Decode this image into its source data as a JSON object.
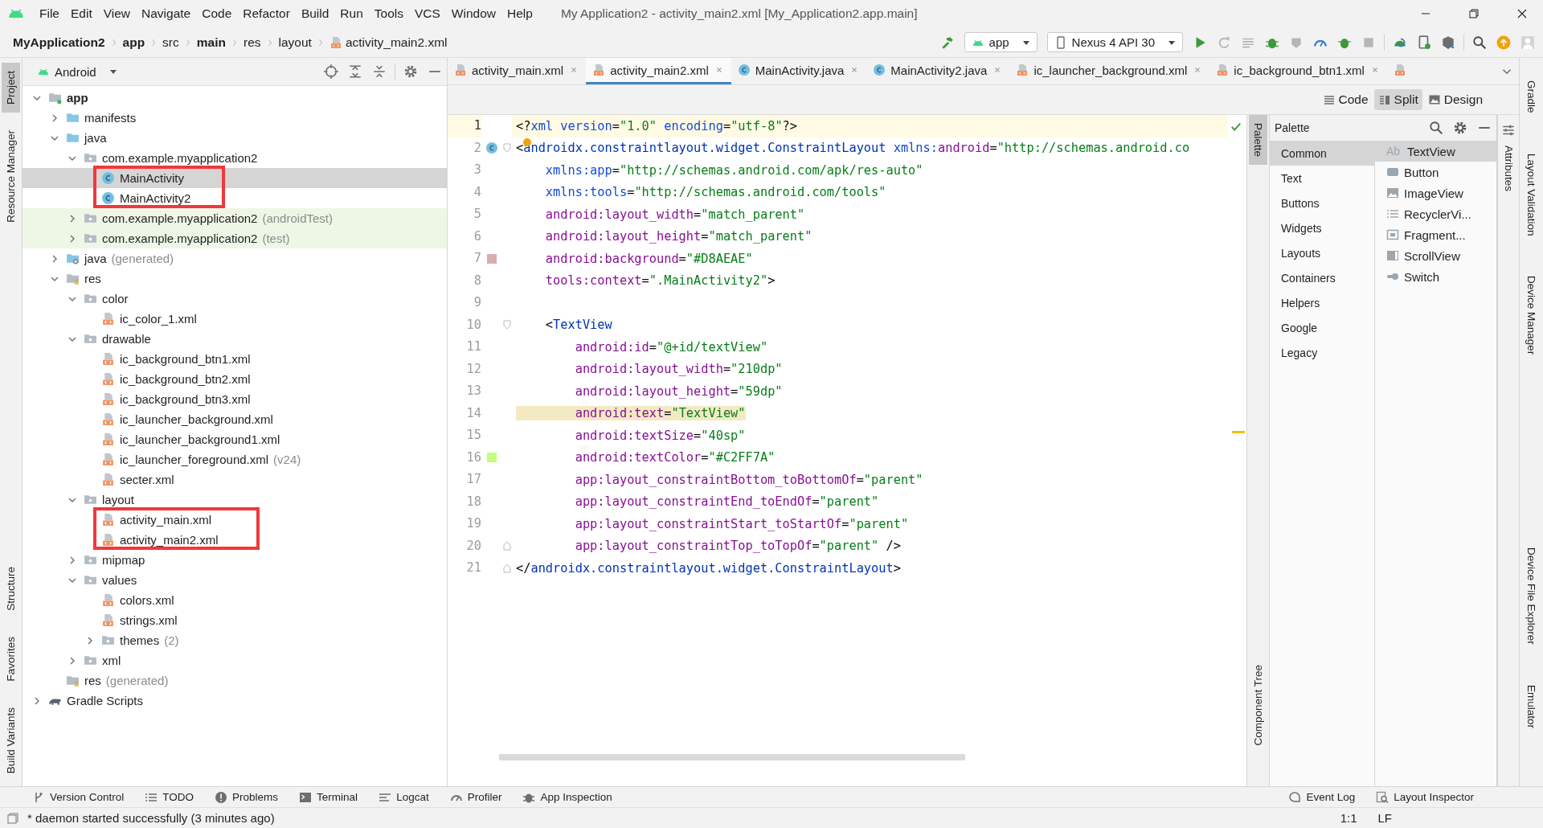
{
  "window": {
    "title": "My Application2 - activity_main2.xml [My_Application2.app.main]",
    "menu": [
      "File",
      "Edit",
      "View",
      "Navigate",
      "Code",
      "Refactor",
      "Build",
      "Run",
      "Tools",
      "VCS",
      "Window",
      "Help"
    ]
  },
  "breadcrumb": [
    {
      "label": "MyApplication2",
      "bold": true,
      "kind": "dir"
    },
    {
      "label": "app",
      "bold": true,
      "kind": "dir"
    },
    {
      "label": "src",
      "bold": false,
      "kind": "dir"
    },
    {
      "label": "main",
      "bold": true,
      "kind": "dir"
    },
    {
      "label": "res",
      "bold": false,
      "kind": "dir"
    },
    {
      "label": "layout",
      "bold": false,
      "kind": "dir"
    },
    {
      "label": "activity_main2.xml",
      "bold": false,
      "kind": "xml"
    }
  ],
  "toolbar": {
    "configuration": "app",
    "device": "Nexus 4 API 30"
  },
  "left_strip": {
    "top": [
      {
        "label": "Project",
        "selected": true
      },
      {
        "label": "Resource Manager",
        "selected": false
      }
    ],
    "bottom": [
      {
        "label": "Structure",
        "selected": false
      },
      {
        "label": "Favorites",
        "selected": false
      },
      {
        "label": "Build Variants",
        "selected": false
      }
    ]
  },
  "project": {
    "view": "Android",
    "tree": [
      {
        "label": "app",
        "kind": "module",
        "expanded": true,
        "selected": false,
        "marked": false,
        "children": [
          {
            "label": "manifests",
            "kind": "folder",
            "expanded": false,
            "selected": false,
            "marked": false
          },
          {
            "label": "java",
            "kind": "folder",
            "expanded": true,
            "selected": false,
            "marked": false,
            "children": [
              {
                "label": "com.example.myapplication2",
                "kind": "package",
                "expanded": true,
                "selected": false,
                "marked": false,
                "children": [
                  {
                    "label": "MainActivity",
                    "kind": "class",
                    "selected": true,
                    "marked": true
                  },
                  {
                    "label": "MainActivity2",
                    "kind": "class",
                    "selected": false,
                    "marked": true
                  }
                ]
              },
              {
                "label": "com.example.myapplication2",
                "suffix": "(androidTest)",
                "kind": "test-package",
                "expanded": false,
                "selected": false,
                "marked": false
              },
              {
                "label": "com.example.myapplication2",
                "suffix": "(test)",
                "kind": "test-package",
                "expanded": false,
                "selected": false,
                "marked": false
              }
            ]
          },
          {
            "label": "java",
            "suffix": "(generated)",
            "kind": "gen-folder",
            "expanded": false,
            "selected": false,
            "marked": false
          },
          {
            "label": "res",
            "kind": "res-folder",
            "expanded": true,
            "selected": false,
            "marked": false,
            "children": [
              {
                "label": "color",
                "kind": "package",
                "expanded": true,
                "selected": false,
                "marked": false,
                "children": [
                  {
                    "label": "ic_color_1.xml",
                    "kind": "xml",
                    "selected": false,
                    "marked": false
                  }
                ]
              },
              {
                "label": "drawable",
                "kind": "package",
                "expanded": true,
                "selected": false,
                "marked": false,
                "children": [
                  {
                    "label": "ic_background_btn1.xml",
                    "kind": "xml",
                    "selected": false,
                    "marked": false
                  },
                  {
                    "label": "ic_background_btn2.xml",
                    "kind": "xml",
                    "selected": false,
                    "marked": false
                  },
                  {
                    "label": "ic_background_btn3.xml",
                    "kind": "xml",
                    "selected": false,
                    "marked": false
                  },
                  {
                    "label": "ic_launcher_background.xml",
                    "kind": "xml",
                    "selected": false,
                    "marked": false
                  },
                  {
                    "label": "ic_launcher_background1.xml",
                    "kind": "xml",
                    "selected": false,
                    "marked": false
                  },
                  {
                    "label": "ic_launcher_foreground.xml",
                    "suffix": "(v24)",
                    "kind": "xml",
                    "selected": false,
                    "marked": false
                  },
                  {
                    "label": "secter.xml",
                    "kind": "xml",
                    "selected": false,
                    "marked": false
                  }
                ]
              },
              {
                "label": "layout",
                "kind": "package",
                "expanded": true,
                "selected": false,
                "marked": false,
                "children": [
                  {
                    "label": "activity_main.xml",
                    "kind": "xml",
                    "selected": false,
                    "marked": true
                  },
                  {
                    "label": "activity_main2.xml",
                    "kind": "xml",
                    "selected": false,
                    "marked": true
                  }
                ]
              },
              {
                "label": "mipmap",
                "kind": "package",
                "expanded": false,
                "selected": false,
                "marked": false
              },
              {
                "label": "values",
                "kind": "package",
                "expanded": true,
                "selected": false,
                "marked": false,
                "children": [
                  {
                    "label": "colors.xml",
                    "kind": "xml",
                    "selected": false,
                    "marked": false
                  },
                  {
                    "label": "strings.xml",
                    "kind": "xml",
                    "selected": false,
                    "marked": false
                  },
                  {
                    "label": "themes",
                    "suffix": "(2)",
                    "kind": "package",
                    "expanded": false,
                    "selected": false,
                    "marked": false
                  }
                ]
              },
              {
                "label": "xml",
                "kind": "package",
                "expanded": false,
                "selected": false,
                "marked": false
              }
            ]
          },
          {
            "label": "res",
            "suffix": "(generated)",
            "kind": "res-folder",
            "selected": false,
            "marked": false
          }
        ]
      },
      {
        "label": "Gradle Scripts",
        "kind": "gradle",
        "expanded": false,
        "selected": false,
        "marked": false
      }
    ]
  },
  "editor": {
    "tabs": [
      {
        "label": "activity_main.xml",
        "kind": "xml",
        "selected": false
      },
      {
        "label": "activity_main2.xml",
        "kind": "xml",
        "selected": true
      },
      {
        "label": "MainActivity.java",
        "kind": "class",
        "selected": false
      },
      {
        "label": "MainActivity2.java",
        "kind": "class",
        "selected": false
      },
      {
        "label": "ic_launcher_background.xml",
        "kind": "xml",
        "selected": false
      },
      {
        "label": "ic_background_btn1.xml",
        "kind": "xml",
        "selected": false
      },
      {
        "kind": "xml",
        "selected": false
      }
    ],
    "view_modes": [
      {
        "label": "Code",
        "kind": "code",
        "selected": false
      },
      {
        "label": "Split",
        "kind": "split",
        "selected": true
      },
      {
        "label": "Design",
        "kind": "design",
        "selected": false
      }
    ],
    "lines": [
      {
        "number": "1",
        "current": true,
        "occurrence": false,
        "tokens": [
          {
            "text": "<?",
            "kind": "p"
          },
          {
            "text": "xml version",
            "kind": "n"
          },
          {
            "text": "=",
            "kind": "p"
          },
          {
            "text": "\"1.0\"",
            "kind": "v"
          },
          {
            "text": " encoding",
            "kind": "n"
          },
          {
            "text": "=",
            "kind": "p"
          },
          {
            "text": "\"utf-8\"",
            "kind": "v"
          },
          {
            "text": "?>",
            "kind": "p"
          }
        ]
      },
      {
        "number": "2",
        "current": false,
        "occurrence": false,
        "marks": [
          {
            "kind": "class"
          },
          {
            "kind": "fold-start"
          }
        ],
        "tokens": [
          {
            "text": "<",
            "kind": "p"
          },
          {
            "text": "androidx.constraintlayout.widget.ConstraintLayout",
            "kind": "t"
          },
          {
            "text": " xmlns:",
            "kind": "n"
          },
          {
            "text": "android",
            "kind": "a"
          },
          {
            "text": "=",
            "kind": "p"
          },
          {
            "text": "\"http://schemas.android.co",
            "kind": "v"
          }
        ]
      },
      {
        "number": "3",
        "current": false,
        "occurrence": false,
        "tokens": [
          {
            "text": "    xmlns:app",
            "kind": "n"
          },
          {
            "text": "=",
            "kind": "p"
          },
          {
            "text": "\"http://schemas.android.com/apk/res-auto\"",
            "kind": "v"
          }
        ]
      },
      {
        "number": "4",
        "current": false,
        "occurrence": false,
        "tokens": [
          {
            "text": "    xmlns:tools",
            "kind": "n"
          },
          {
            "text": "=",
            "kind": "p"
          },
          {
            "text": "\"http://schemas.android.com/tools\"",
            "kind": "v"
          }
        ]
      },
      {
        "number": "5",
        "current": false,
        "occurrence": false,
        "tokens": [
          {
            "text": "    android:layout_width",
            "kind": "a"
          },
          {
            "text": "=",
            "kind": "p"
          },
          {
            "text": "\"match_parent\"",
            "kind": "v"
          }
        ]
      },
      {
        "number": "6",
        "current": false,
        "occurrence": false,
        "tokens": [
          {
            "text": "    android:layout_height",
            "kind": "a"
          },
          {
            "text": "=",
            "kind": "p"
          },
          {
            "text": "\"match_parent\"",
            "kind": "v"
          }
        ]
      },
      {
        "number": "7",
        "current": false,
        "occurrence": false,
        "marks": [
          {
            "kind": "swatch",
            "color": "#d8aeae"
          }
        ],
        "tokens": [
          {
            "text": "    android:background",
            "kind": "a"
          },
          {
            "text": "=",
            "kind": "p"
          },
          {
            "text": "\"#D8AEAE\"",
            "kind": "v"
          }
        ]
      },
      {
        "number": "8",
        "current": false,
        "occurrence": false,
        "tokens": [
          {
            "text": "    tools:context",
            "kind": "a"
          },
          {
            "text": "=",
            "kind": "p"
          },
          {
            "text": "\".MainActivity2\"",
            "kind": "v"
          },
          {
            "text": ">",
            "kind": "p"
          }
        ]
      },
      {
        "number": "9",
        "current": false
      },
      {
        "number": "10",
        "current": false,
        "occurrence": false,
        "marks": [
          {
            "kind": "fold-start"
          }
        ],
        "tokens": [
          {
            "text": "    <",
            "kind": "p"
          },
          {
            "text": "TextView",
            "kind": "t"
          }
        ]
      },
      {
        "number": "11",
        "current": false,
        "occurrence": false,
        "tokens": [
          {
            "text": "        android:id",
            "kind": "a"
          },
          {
            "text": "=",
            "kind": "p"
          },
          {
            "text": "\"@+id/textView\"",
            "kind": "v"
          }
        ]
      },
      {
        "number": "12",
        "current": false,
        "occurrence": false,
        "tokens": [
          {
            "text": "        android:layout_width",
            "kind": "a"
          },
          {
            "text": "=",
            "kind": "p"
          },
          {
            "text": "\"210dp\"",
            "kind": "v"
          }
        ]
      },
      {
        "number": "13",
        "current": false,
        "occurrence": false,
        "tokens": [
          {
            "text": "        android:layout_height",
            "kind": "a"
          },
          {
            "text": "=",
            "kind": "p"
          },
          {
            "text": "\"59dp\"",
            "kind": "v"
          }
        ]
      },
      {
        "number": "14",
        "current": false,
        "occurrence": true,
        "tokens": [
          {
            "text": "        android:text",
            "kind": "a"
          },
          {
            "text": "=",
            "kind": "p"
          },
          {
            "text": "\"TextView\"",
            "kind": "v"
          }
        ]
      },
      {
        "number": "15",
        "current": false,
        "occurrence": false,
        "tokens": [
          {
            "text": "        android:textSize",
            "kind": "a"
          },
          {
            "text": "=",
            "kind": "p"
          },
          {
            "text": "\"40sp\"",
            "kind": "v"
          }
        ]
      },
      {
        "number": "16",
        "current": false,
        "occurrence": false,
        "marks": [
          {
            "kind": "swatch",
            "color": "#c2ff7a"
          }
        ],
        "tokens": [
          {
            "text": "        android:textColor",
            "kind": "a"
          },
          {
            "text": "=",
            "kind": "p"
          },
          {
            "text": "\"#C2FF7A\"",
            "kind": "v"
          }
        ]
      },
      {
        "number": "17",
        "current": false,
        "occurrence": false,
        "tokens": [
          {
            "text": "        app:layout_constraintBottom_toBottomOf",
            "kind": "a"
          },
          {
            "text": "=",
            "kind": "p"
          },
          {
            "text": "\"parent\"",
            "kind": "v"
          }
        ]
      },
      {
        "number": "18",
        "current": false,
        "occurrence": false,
        "tokens": [
          {
            "text": "        app:layout_constraintEnd_toEndOf",
            "kind": "a"
          },
          {
            "text": "=",
            "kind": "p"
          },
          {
            "text": "\"parent\"",
            "kind": "v"
          }
        ]
      },
      {
        "number": "19",
        "current": false,
        "occurrence": false,
        "tokens": [
          {
            "text": "        app:layout_constraintStart_toStartOf",
            "kind": "a"
          },
          {
            "text": "=",
            "kind": "p"
          },
          {
            "text": "\"parent\"",
            "kind": "v"
          }
        ]
      },
      {
        "number": "20",
        "current": false,
        "occurrence": false,
        "marks": [
          {
            "kind": "fold-end"
          }
        ],
        "tokens": [
          {
            "text": "        app:layout_constraintTop_toTopOf",
            "kind": "a"
          },
          {
            "text": "=",
            "kind": "p"
          },
          {
            "text": "\"parent\"",
            "kind": "v"
          },
          {
            "text": " />",
            "kind": "p"
          }
        ]
      },
      {
        "number": "21",
        "current": false,
        "occurrence": false,
        "marks": [
          {
            "kind": "fold-end"
          }
        ],
        "tokens": [
          {
            "text": "</",
            "kind": "p"
          },
          {
            "text": "androidx.constraintlayout.widget.ConstraintLayout",
            "kind": "t"
          },
          {
            "text": ">",
            "kind": "p"
          }
        ]
      }
    ]
  },
  "palette_strip": {
    "top": [
      {
        "label": "Palette",
        "selected": true
      }
    ],
    "bottom": [
      {
        "label": "Component Tree",
        "selected": false
      }
    ]
  },
  "palette": {
    "title": "Palette",
    "categories": [
      {
        "label": "Common",
        "selected": true
      },
      {
        "label": "Text",
        "selected": false
      },
      {
        "label": "Buttons",
        "selected": false
      },
      {
        "label": "Widgets",
        "selected": false
      },
      {
        "label": "Layouts",
        "selected": false
      },
      {
        "label": "Containers",
        "selected": false
      },
      {
        "label": "Helpers",
        "selected": false
      },
      {
        "label": "Google",
        "selected": false
      },
      {
        "label": "Legacy",
        "selected": false
      }
    ],
    "items": [
      {
        "label": "TextView",
        "kind": "text",
        "glyph": "Ab",
        "selected": true
      },
      {
        "label": "Button",
        "kind": "button",
        "selected": false
      },
      {
        "label": "ImageView",
        "kind": "image",
        "selected": false
      },
      {
        "label": "RecyclerVi...",
        "kind": "list",
        "selected": false
      },
      {
        "label": "Fragment...",
        "kind": "fragment",
        "selected": false
      },
      {
        "label": "ScrollView",
        "kind": "scroll",
        "selected": false
      },
      {
        "label": "Switch",
        "kind": "switch",
        "selected": false
      }
    ]
  },
  "attributes_strip": {
    "top": [
      {
        "label": "Attributes",
        "selected": false
      }
    ]
  },
  "right_strip": {
    "top": [
      {
        "label": "Gradle",
        "selected": false
      },
      {
        "label": "Layout Validation",
        "selected": false
      },
      {
        "label": "Device Manager",
        "selected": false
      }
    ],
    "bottom": [
      {
        "label": "Device File Explorer",
        "selected": false
      },
      {
        "label": "Emulator",
        "selected": false
      }
    ]
  },
  "tool_windows": [
    {
      "label": "Version Control",
      "kind": "vcs"
    },
    {
      "label": "TODO",
      "kind": "todo"
    },
    {
      "label": "Problems",
      "kind": "problems"
    },
    {
      "label": "Terminal",
      "kind": "terminal"
    },
    {
      "label": "Logcat",
      "kind": "logcat"
    },
    {
      "label": "Profiler",
      "kind": "profiler"
    },
    {
      "label": "App Inspection",
      "kind": "inspection"
    }
  ],
  "tool_windows_right": [
    {
      "label": "Event Log",
      "kind": "eventlog"
    },
    {
      "label": "Layout Inspector",
      "kind": "layoutinspector"
    }
  ],
  "status_bar": {
    "message": "* daemon started successfully (3 minutes ago)",
    "position": "1:1",
    "line_separator": "LF"
  }
}
